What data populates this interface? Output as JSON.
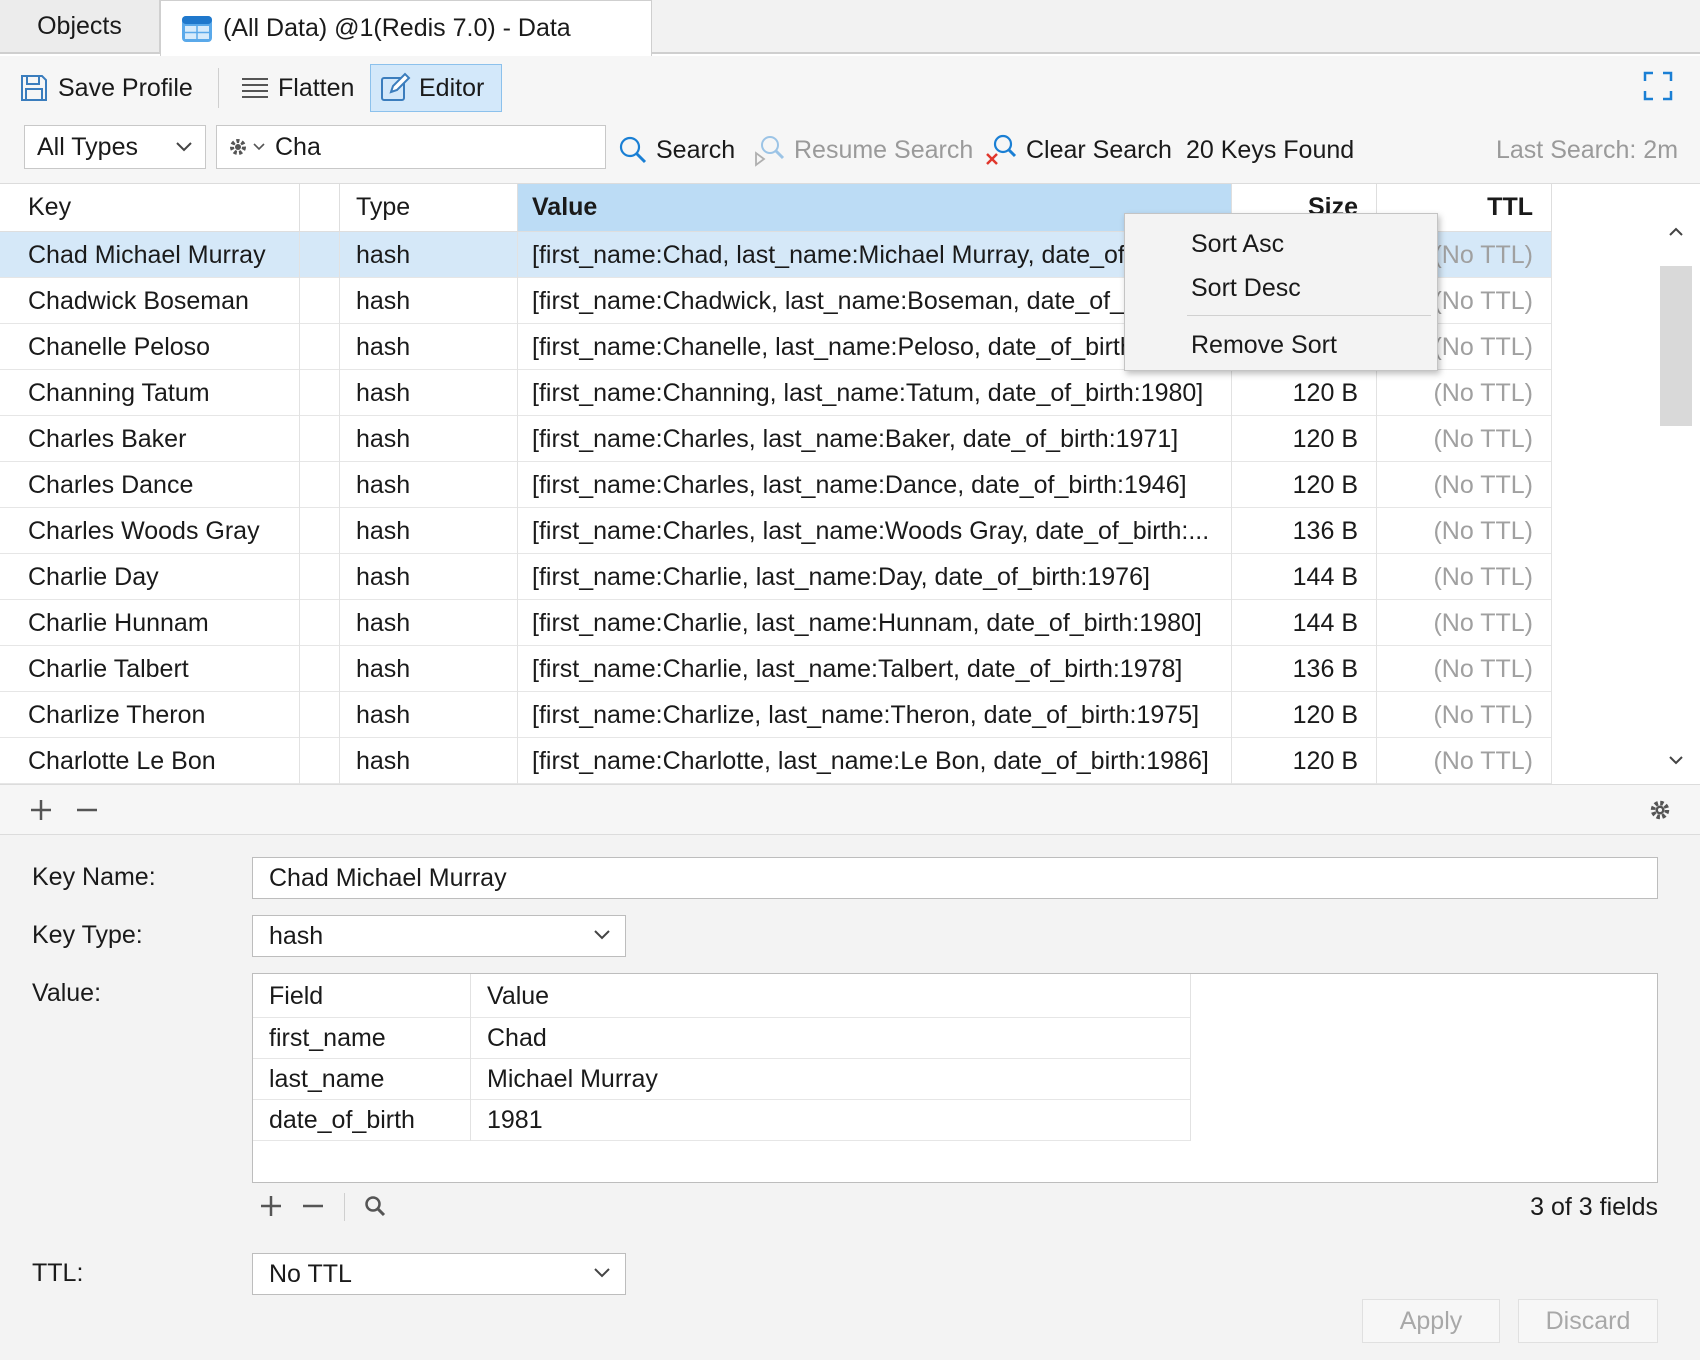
{
  "tabs": {
    "objects": "Objects",
    "data": "(All Data) @1(Redis 7.0) - Data"
  },
  "toolbar": {
    "save_profile": "Save Profile",
    "flatten": "Flatten",
    "editor": "Editor"
  },
  "filter": {
    "type_select": "All Types",
    "search_value": "Cha",
    "search": "Search",
    "resume_search": "Resume Search",
    "clear_search": "Clear Search",
    "keys_found": "20 Keys Found",
    "last_search": "Last Search: 2m"
  },
  "grid": {
    "columns": [
      "Key",
      "Type",
      "Value",
      "Size",
      "TTL"
    ],
    "rows": [
      {
        "key": "Chad Michael Murray",
        "type": "hash",
        "value": "[first_name:Chad, last_name:Michael Murray, date_of_birth:1981]",
        "size": "",
        "ttl": "(No TTL)"
      },
      {
        "key": "Chadwick Boseman",
        "type": "hash",
        "value": "[first_name:Chadwick, last_name:Boseman, date_of_birth:1976]",
        "size": "",
        "ttl": "(No TTL)"
      },
      {
        "key": "Chanelle Peloso",
        "type": "hash",
        "value": "[first_name:Chanelle, last_name:Peloso, date_of_birth:1994]",
        "size": "",
        "ttl": "(No TTL)"
      },
      {
        "key": "Channing Tatum",
        "type": "hash",
        "value": "[first_name:Channing, last_name:Tatum, date_of_birth:1980]",
        "size": "120 B",
        "ttl": "(No TTL)"
      },
      {
        "key": "Charles Baker",
        "type": "hash",
        "value": "[first_name:Charles, last_name:Baker, date_of_birth:1971]",
        "size": "120 B",
        "ttl": "(No TTL)"
      },
      {
        "key": "Charles Dance",
        "type": "hash",
        "value": "[first_name:Charles, last_name:Dance, date_of_birth:1946]",
        "size": "120 B",
        "ttl": "(No TTL)"
      },
      {
        "key": "Charles Woods Gray",
        "type": "hash",
        "value": "[first_name:Charles, last_name:Woods Gray, date_of_birth:...",
        "size": "136 B",
        "ttl": "(No TTL)"
      },
      {
        "key": "Charlie Day",
        "type": "hash",
        "value": "[first_name:Charlie, last_name:Day, date_of_birth:1976]",
        "size": "144 B",
        "ttl": "(No TTL)"
      },
      {
        "key": "Charlie Hunnam",
        "type": "hash",
        "value": "[first_name:Charlie, last_name:Hunnam, date_of_birth:1980]",
        "size": "144 B",
        "ttl": "(No TTL)"
      },
      {
        "key": "Charlie Talbert",
        "type": "hash",
        "value": "[first_name:Charlie, last_name:Talbert, date_of_birth:1978]",
        "size": "136 B",
        "ttl": "(No TTL)"
      },
      {
        "key": "Charlize Theron",
        "type": "hash",
        "value": "[first_name:Charlize, last_name:Theron, date_of_birth:1975]",
        "size": "120 B",
        "ttl": "(No TTL)"
      },
      {
        "key": "Charlotte Le Bon",
        "type": "hash",
        "value": "[first_name:Charlotte, last_name:Le Bon, date_of_birth:1986]",
        "size": "120 B",
        "ttl": "(No TTL)"
      }
    ]
  },
  "context_menu": {
    "sort_asc": "Sort Asc",
    "sort_desc": "Sort Desc",
    "remove_sort": "Remove Sort"
  },
  "editor": {
    "key_name_label": "Key Name:",
    "key_name": "Chad Michael Murray",
    "key_type_label": "Key Type:",
    "key_type": "hash",
    "value_label": "Value:",
    "value_columns": [
      "Field",
      "Value"
    ],
    "fields": [
      {
        "field": "first_name",
        "value": "Chad"
      },
      {
        "field": "last_name",
        "value": "Michael Murray"
      },
      {
        "field": "date_of_birth",
        "value": "1981"
      }
    ],
    "fields_count": "3 of 3 fields",
    "ttl_label": "TTL:",
    "ttl": "No TTL",
    "apply": "Apply",
    "discard": "Discard"
  },
  "colors": {
    "selected_row": "#d5e8f8",
    "sorted_header": "#bcdcf5",
    "accent": "#1a7fd4"
  }
}
